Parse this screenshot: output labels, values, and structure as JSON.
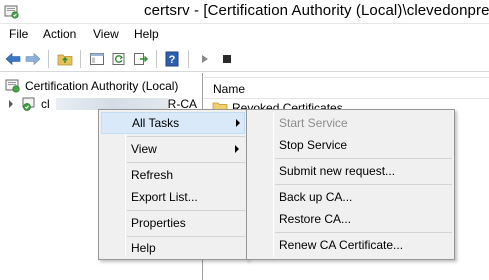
{
  "window": {
    "title": "certsrv - [Certification Authority (Local)\\clevedonpre"
  },
  "menu": [
    "File",
    "Action",
    "View",
    "Help"
  ],
  "tree": {
    "root": "Certification Authority (Local)",
    "ca_node": "cl",
    "ca_node_suffix": "R-CA"
  },
  "list": {
    "column_name": "Name",
    "items": [
      "Revoked Certificates"
    ]
  },
  "context_menu": {
    "all_tasks": "All Tasks",
    "view": "View",
    "refresh": "Refresh",
    "export_list": "Export List...",
    "properties": "Properties",
    "help": "Help"
  },
  "submenu": {
    "start_service": "Start Service",
    "stop_service": "Stop Service",
    "submit_new_request": "Submit new request...",
    "back_up_ca": "Back up CA...",
    "restore_ca": "Restore CA...",
    "renew_ca_certificate": "Renew CA Certificate..."
  },
  "colors": {
    "highlight": "#d9e9f9",
    "menu_bg": "#f0f0f0",
    "disabled_text": "#8d8d8d"
  }
}
